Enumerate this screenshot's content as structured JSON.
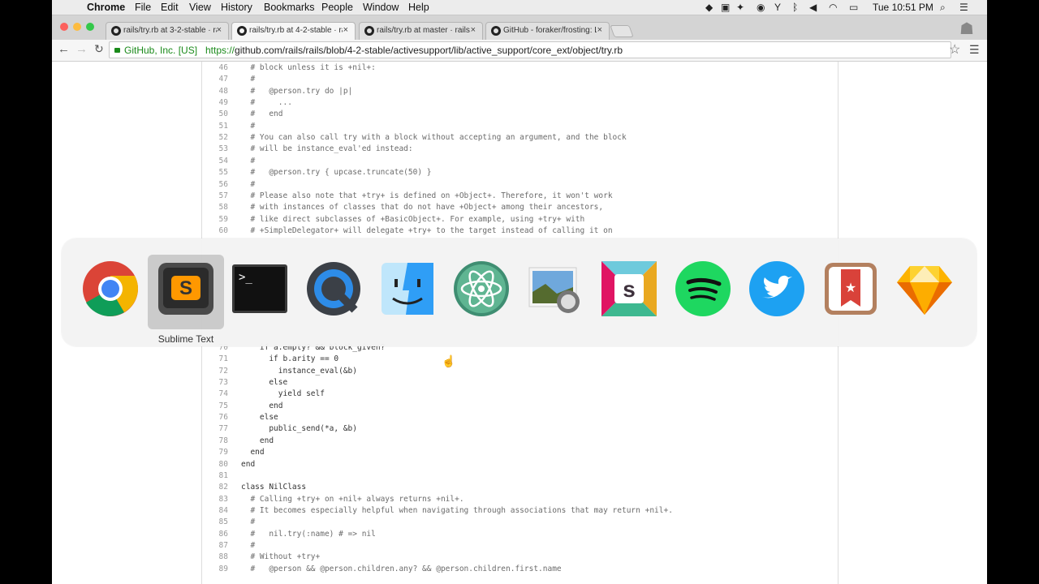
{
  "menubar": {
    "items": [
      "Chrome",
      "File",
      "Edit",
      "View",
      "History",
      "Bookmarks",
      "People",
      "Window",
      "Help"
    ],
    "clock": "Tue 10:51 PM"
  },
  "tabs": [
    {
      "title": "rails/try.rb at 3-2-stable · rails/rails",
      "close": "×"
    },
    {
      "title": "rails/try.rb at 4-2-stable · rails/rails",
      "close": "×"
    },
    {
      "title": "rails/try.rb at master · rails/rails",
      "close": "×"
    },
    {
      "title": "GitHub - foraker/frosting: L",
      "close": "×"
    }
  ],
  "toolbar": {
    "security": "GitHub, Inc. [US]",
    "url_proto": "https://",
    "url_rest": "github.com/rails/rails/blob/4-2-stable/activesupport/lib/active_support/core_ext/object/try.rb"
  },
  "code_lines": [
    {
      "n": "46",
      "t": "  # block unless it is +nil+:",
      "c": true
    },
    {
      "n": "47",
      "t": "  #",
      "c": true
    },
    {
      "n": "48",
      "t": "  #   @person.try do |p|",
      "c": true
    },
    {
      "n": "49",
      "t": "  #     ...",
      "c": true
    },
    {
      "n": "50",
      "t": "  #   end",
      "c": true
    },
    {
      "n": "51",
      "t": "  #",
      "c": true
    },
    {
      "n": "52",
      "t": "  # You can also call try with a block without accepting an argument, and the block",
      "c": true
    },
    {
      "n": "53",
      "t": "  # will be instance_eval'ed instead:",
      "c": true
    },
    {
      "n": "54",
      "t": "  #",
      "c": true
    },
    {
      "n": "55",
      "t": "  #   @person.try { upcase.truncate(50) }",
      "c": true
    },
    {
      "n": "56",
      "t": "  #",
      "c": true
    },
    {
      "n": "57",
      "t": "  # Please also note that +try+ is defined on +Object+. Therefore, it won't work",
      "c": true
    },
    {
      "n": "58",
      "t": "  # with instances of classes that do not have +Object+ among their ancestors,",
      "c": true
    },
    {
      "n": "59",
      "t": "  # like direct subclasses of +BasicObject+. For example, using +try+ with",
      "c": true
    },
    {
      "n": "60",
      "t": "  # +SimpleDelegator+ will delegate +try+ to the target instead of calling it on",
      "c": true
    },
    {
      "n": "70",
      "t": "    if a.empty? && block_given?",
      "c": false
    },
    {
      "n": "71",
      "t": "      if b.arity == 0",
      "c": false
    },
    {
      "n": "72",
      "t": "        instance_eval(&b)",
      "c": false
    },
    {
      "n": "73",
      "t": "      else",
      "c": false
    },
    {
      "n": "74",
      "t": "        yield self",
      "c": false
    },
    {
      "n": "75",
      "t": "      end",
      "c": false
    },
    {
      "n": "76",
      "t": "    else",
      "c": false
    },
    {
      "n": "77",
      "t": "      public_send(*a, &b)",
      "c": false
    },
    {
      "n": "78",
      "t": "    end",
      "c": false
    },
    {
      "n": "79",
      "t": "  end",
      "c": false
    },
    {
      "n": "80",
      "t": "end",
      "c": false
    },
    {
      "n": "81",
      "t": "",
      "c": false
    },
    {
      "n": "82",
      "t": "class NilClass",
      "c": false
    },
    {
      "n": "83",
      "t": "  # Calling +try+ on +nil+ always returns +nil+.",
      "c": true
    },
    {
      "n": "84",
      "t": "  # It becomes especially helpful when navigating through associations that may return +nil+.",
      "c": true
    },
    {
      "n": "85",
      "t": "  #",
      "c": true
    },
    {
      "n": "86",
      "t": "  #   nil.try(:name) # => nil",
      "c": true
    },
    {
      "n": "87",
      "t": "  #",
      "c": true
    },
    {
      "n": "88",
      "t": "  # Without +try+",
      "c": true
    },
    {
      "n": "89",
      "t": "  #   @person && @person.children.any? && @person.children.first.name",
      "c": true
    }
  ],
  "switcher": {
    "apps": [
      {
        "name": "chrome-icon"
      },
      {
        "name": "sublime-text-icon"
      },
      {
        "name": "terminal-icon"
      },
      {
        "name": "quicktime-icon"
      },
      {
        "name": "finder-icon"
      },
      {
        "name": "atom-icon"
      },
      {
        "name": "preview-icon"
      },
      {
        "name": "slack-icon"
      },
      {
        "name": "spotify-icon"
      },
      {
        "name": "twitter-icon"
      },
      {
        "name": "wunderlist-icon"
      },
      {
        "name": "sketch-icon"
      }
    ],
    "selected_label": "Sublime Text"
  }
}
